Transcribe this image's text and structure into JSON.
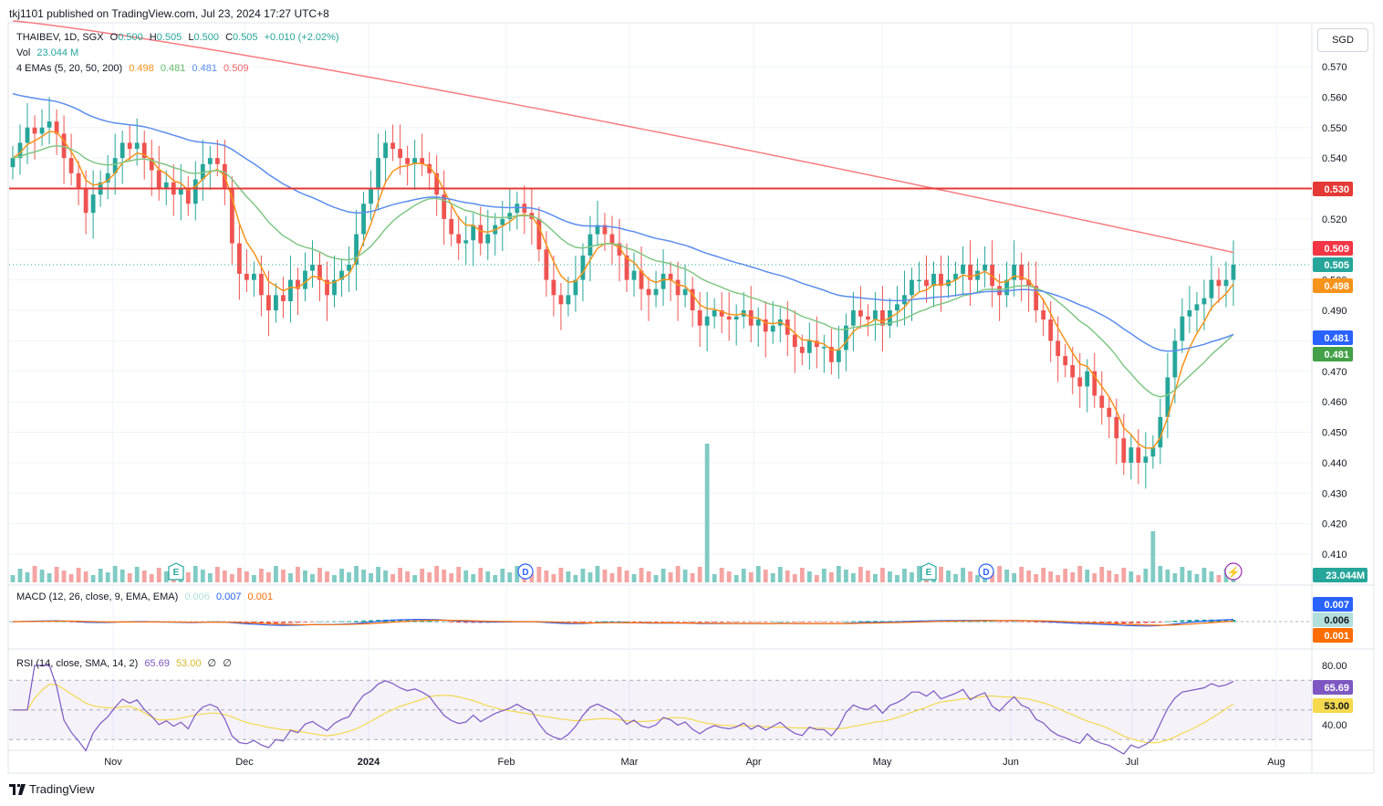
{
  "header": {
    "publisher": "tkj1101 published on TradingView.com, Jul 23, 2024 17:27 UTC+8"
  },
  "symbol_line": {
    "symbol": "THAIBEV, 1D, SGX",
    "o_label": "O",
    "o": "0.500",
    "h_label": "H",
    "h": "0.505",
    "l_label": "L",
    "l": "0.500",
    "c_label": "C",
    "c": "0.505",
    "change": "+0.010 (+2.02%)"
  },
  "vol_line": {
    "label": "Vol",
    "value": "23.044 M"
  },
  "ema_line": {
    "label": "4 EMAs (5, 20, 50, 200)",
    "v1": "0.498",
    "v2": "0.481",
    "v3": "0.481",
    "v4": "0.509"
  },
  "macd_line": {
    "label": "MACD (12, 26, close, 9, EMA, EMA)",
    "v1": "0.006",
    "v2": "0.007",
    "v3": "0.001"
  },
  "rsi_line": {
    "label": "RSI (14, close, SMA, 14, 2)",
    "v1": "65.69",
    "v2": "53.00",
    "v3": "∅",
    "v4": "∅"
  },
  "currency_button": "SGD",
  "brand": "TradingView",
  "colors": {
    "up": "#26a69a",
    "down": "#ef5350",
    "ema5": "#f7931a",
    "ema20": "#81c784",
    "ema50": "#5b8def",
    "ema200": "#f77c80",
    "hline": "#e53935",
    "rsi": "#7e57c2",
    "rsi_ma": "#f5d94e"
  },
  "price_axis": {
    "ticks": [
      "0.570",
      "0.560",
      "0.550",
      "0.540",
      "0.530",
      "0.520",
      "0.510",
      "0.500",
      "0.490",
      "0.480",
      "0.470",
      "0.460",
      "0.450",
      "0.440",
      "0.430",
      "0.420",
      "0.410"
    ]
  },
  "price_labels": {
    "hline": "0.530",
    "ema200": "0.509",
    "last": "0.505",
    "ema5": "0.498",
    "ema50": "0.481",
    "ema20": "0.481",
    "volume": "23.044M"
  },
  "macd_labels": {
    "macd": "0.007",
    "hist": "0.006",
    "signal": "0.001"
  },
  "rsi_axis": {
    "ticks": [
      "80.00",
      "40.00"
    ],
    "rsi": "65.69",
    "ma": "53.00"
  },
  "time_axis": [
    "Nov",
    "Dec",
    "2024",
    "Feb",
    "Mar",
    "Apr",
    "May",
    "Jun",
    "Jul",
    "Aug"
  ],
  "event_markers": [
    "E",
    "D",
    "E",
    "D"
  ],
  "chart_data": {
    "type": "candlestick",
    "symbol": "THAIBEV",
    "interval": "1D",
    "ylim": [
      0.405,
      0.575
    ],
    "horizontal_line": 0.53,
    "last": {
      "open": 0.5,
      "high": 0.505,
      "low": 0.5,
      "close": 0.505,
      "volume": "23.044M"
    },
    "ema": {
      "ema5": 0.498,
      "ema20": 0.481,
      "ema50": 0.481,
      "ema200": 0.509
    },
    "closes": [
      0.54,
      0.545,
      0.55,
      0.548,
      0.55,
      0.552,
      0.548,
      0.54,
      0.535,
      0.53,
      0.522,
      0.528,
      0.532,
      0.535,
      0.54,
      0.545,
      0.543,
      0.545,
      0.54,
      0.536,
      0.53,
      0.532,
      0.528,
      0.53,
      0.525,
      0.533,
      0.538,
      0.54,
      0.538,
      0.53,
      0.512,
      0.502,
      0.5,
      0.502,
      0.495,
      0.49,
      0.495,
      0.493,
      0.5,
      0.497,
      0.503,
      0.505,
      0.5,
      0.495,
      0.5,
      0.503,
      0.505,
      0.515,
      0.525,
      0.53,
      0.54,
      0.545,
      0.543,
      0.54,
      0.538,
      0.54,
      0.538,
      0.535,
      0.528,
      0.52,
      0.515,
      0.512,
      0.513,
      0.518,
      0.512,
      0.515,
      0.518,
      0.52,
      0.522,
      0.525,
      0.522,
      0.52,
      0.51,
      0.5,
      0.495,
      0.492,
      0.495,
      0.5,
      0.508,
      0.515,
      0.518,
      0.515,
      0.512,
      0.508,
      0.5,
      0.503,
      0.497,
      0.495,
      0.497,
      0.502,
      0.5,
      0.495,
      0.497,
      0.49,
      0.485,
      0.488,
      0.49,
      0.488,
      0.487,
      0.488,
      0.49,
      0.485,
      0.487,
      0.483,
      0.485,
      0.487,
      0.482,
      0.478,
      0.476,
      0.48,
      0.478,
      0.478,
      0.473,
      0.477,
      0.485,
      0.49,
      0.488,
      0.487,
      0.49,
      0.485,
      0.49,
      0.492,
      0.495,
      0.5,
      0.5,
      0.498,
      0.502,
      0.498,
      0.5,
      0.502,
      0.505,
      0.5,
      0.503,
      0.505,
      0.498,
      0.495,
      0.5,
      0.505,
      0.5,
      0.498,
      0.49,
      0.487,
      0.48,
      0.475,
      0.472,
      0.468,
      0.465,
      0.47,
      0.462,
      0.458,
      0.455,
      0.448,
      0.44,
      0.445,
      0.44,
      0.442,
      0.445,
      0.455,
      0.468,
      0.48,
      0.488,
      0.49,
      0.492,
      0.494,
      0.5,
      0.498,
      0.5,
      0.505
    ],
    "macd": {
      "macd": 0.007,
      "histogram": 0.006,
      "signal": 0.001
    },
    "rsi": {
      "value": 65.69,
      "ma": 53.0,
      "upper_band": 70,
      "lower_band": 30
    }
  }
}
